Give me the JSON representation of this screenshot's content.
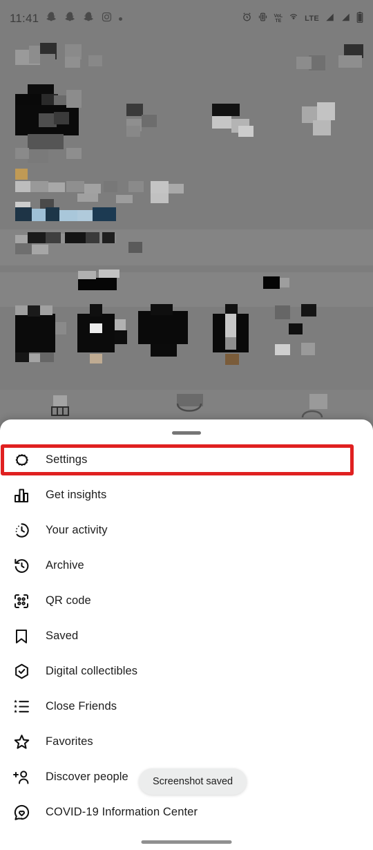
{
  "status_bar": {
    "time": "11:41",
    "left_icons": [
      "snapchat-icon",
      "snapchat-icon",
      "snapchat-icon",
      "instagram-icon",
      "overflow-dot-icon"
    ],
    "right_icons": [
      "alarm-icon",
      "vibrate-icon",
      "volte-icon",
      "hotspot-icon",
      "lte-icon",
      "signal-bars-icon",
      "signal-bars-icon",
      "battery-icon"
    ],
    "network_label": "LTE",
    "volte_top": "VoL",
    "volte_bottom": "TE"
  },
  "sheet": {
    "grabber": "drag-handle",
    "items": [
      {
        "icon": "gear-icon",
        "label": "Settings"
      },
      {
        "icon": "bar-chart-icon",
        "label": "Get insights"
      },
      {
        "icon": "activity-clock-icon",
        "label": "Your activity"
      },
      {
        "icon": "archive-clock-icon",
        "label": "Archive"
      },
      {
        "icon": "qr-code-icon",
        "label": "QR code"
      },
      {
        "icon": "bookmark-icon",
        "label": "Saved"
      },
      {
        "icon": "shield-check-icon",
        "label": "Digital collectibles"
      },
      {
        "icon": "star-list-icon",
        "label": "Close Friends"
      },
      {
        "icon": "star-icon",
        "label": "Favorites"
      },
      {
        "icon": "add-person-icon",
        "label": "Discover people"
      },
      {
        "icon": "covid-heart-icon",
        "label": "COVID-19 Information Center"
      }
    ]
  },
  "toast": {
    "message": "Screenshot saved"
  },
  "annotation": {
    "target": "Settings",
    "color": "#e02020"
  },
  "colors": {
    "scrim": "#7d7d7d",
    "sheet_background": "#ffffff",
    "text_primary": "#1c1c1c",
    "toast_background": "#eceded",
    "highlight": "#e02020"
  }
}
